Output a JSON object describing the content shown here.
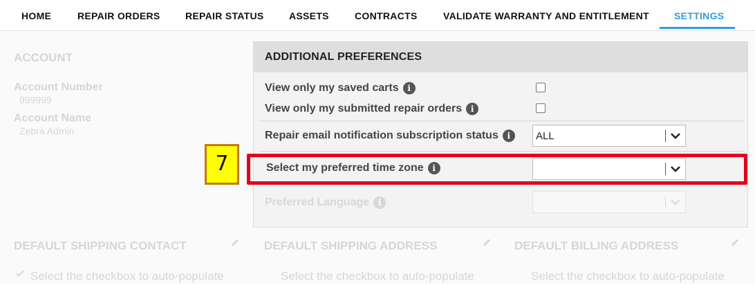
{
  "nav": {
    "items": [
      {
        "label": "HOME"
      },
      {
        "label": "REPAIR ORDERS"
      },
      {
        "label": "REPAIR STATUS"
      },
      {
        "label": "ASSETS"
      },
      {
        "label": "CONTRACTS"
      },
      {
        "label": "VALIDATE WARRANTY AND ENTITLEMENT"
      },
      {
        "label": "SETTINGS"
      }
    ],
    "active": "SETTINGS",
    "accent_color": "#2f9ed6"
  },
  "account": {
    "heading": "ACCOUNT",
    "number_label": "Account Number",
    "number_value": "999999",
    "name_label": "Account Name",
    "name_value": "Zebra Admin"
  },
  "preferences": {
    "title": "ADDITIONAL PREFERENCES",
    "saved_carts_label": "View only my saved carts",
    "submitted_orders_label": "View only my submitted repair orders",
    "email_status_label": "Repair email notification subscription status",
    "email_status_value": "ALL",
    "time_zone_label": "Select my preferred time zone",
    "time_zone_value": "",
    "language_label": "Preferred Language",
    "language_value": ""
  },
  "bottom": {
    "shipping_contact": "DEFAULT SHIPPING CONTACT",
    "shipping_address": "DEFAULT SHIPPING ADDRESS",
    "billing_address": "DEFAULT BILLING ADDRESS",
    "hint": "Select the checkbox to auto-populate"
  },
  "annotation": {
    "step_number": "7",
    "highlight_color": "#e3001b",
    "badge_color": "#ffff00"
  }
}
